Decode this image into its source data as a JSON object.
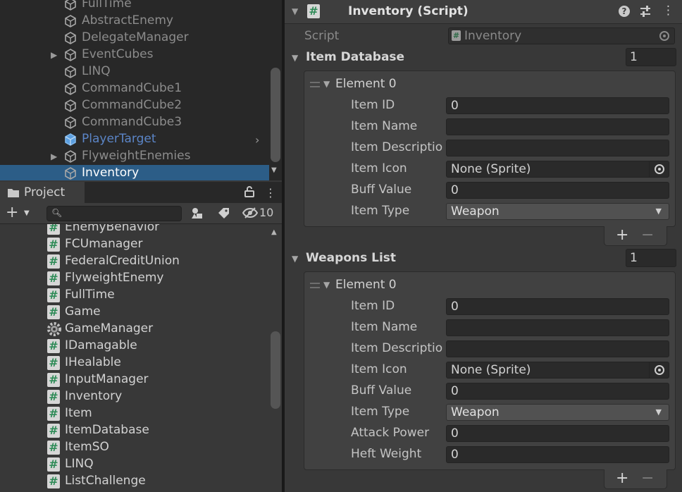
{
  "hierarchy": {
    "items": [
      {
        "label": "FullTime",
        "arrow": false,
        "style": "normal"
      },
      {
        "label": "AbstractEnemy",
        "arrow": false,
        "style": "normal"
      },
      {
        "label": "DelegateManager",
        "arrow": false,
        "style": "normal"
      },
      {
        "label": "EventCubes",
        "arrow": true,
        "style": "normal"
      },
      {
        "label": "LINQ",
        "arrow": false,
        "style": "normal"
      },
      {
        "label": "CommandCube1",
        "arrow": false,
        "style": "normal"
      },
      {
        "label": "CommandCube2",
        "arrow": false,
        "style": "normal"
      },
      {
        "label": "CommandCube3",
        "arrow": false,
        "style": "normal"
      },
      {
        "label": "PlayerTarget",
        "arrow": false,
        "style": "prefab"
      },
      {
        "label": "FlyweightEnemies",
        "arrow": true,
        "style": "normal"
      },
      {
        "label": "Inventory",
        "arrow": false,
        "style": "selected"
      }
    ]
  },
  "project": {
    "tab_label": "Project",
    "search_placeholder": "",
    "hidden_count": "10",
    "files": [
      {
        "label": "EnemyBehavior",
        "icon": "script"
      },
      {
        "label": "FCUmanager",
        "icon": "script"
      },
      {
        "label": "FederalCreditUnion",
        "icon": "script"
      },
      {
        "label": "FlyweightEnemy",
        "icon": "script"
      },
      {
        "label": "FullTime",
        "icon": "script"
      },
      {
        "label": "Game",
        "icon": "script"
      },
      {
        "label": "GameManager",
        "icon": "gear"
      },
      {
        "label": "IDamagable",
        "icon": "script"
      },
      {
        "label": "IHealable",
        "icon": "script"
      },
      {
        "label": "InputManager",
        "icon": "script"
      },
      {
        "label": "Inventory",
        "icon": "script"
      },
      {
        "label": "Item",
        "icon": "script"
      },
      {
        "label": "ItemDatabase",
        "icon": "script"
      },
      {
        "label": "ItemSO",
        "icon": "script"
      },
      {
        "label": "LINQ",
        "icon": "script"
      },
      {
        "label": "ListChallenge",
        "icon": "script"
      }
    ]
  },
  "inspector": {
    "component_title": "Inventory (Script)",
    "script_label": "Script",
    "script_value": "Inventory",
    "item_database": {
      "title": "Item Database",
      "size": "1",
      "element_title": "Element 0",
      "fields": {
        "item_id": {
          "label": "Item ID",
          "value": "0"
        },
        "item_name": {
          "label": "Item Name",
          "value": ""
        },
        "item_description": {
          "label": "Item Descriptio",
          "value": ""
        },
        "item_icon": {
          "label": "Item Icon",
          "value": "None (Sprite)"
        },
        "buff_value": {
          "label": "Buff Value",
          "value": "0"
        },
        "item_type": {
          "label": "Item Type",
          "value": "Weapon"
        }
      }
    },
    "weapons_list": {
      "title": "Weapons List",
      "size": "1",
      "element_title": "Element 0",
      "fields": {
        "item_id": {
          "label": "Item ID",
          "value": "0"
        },
        "item_name": {
          "label": "Item Name",
          "value": ""
        },
        "item_description": {
          "label": "Item Descriptio",
          "value": ""
        },
        "item_icon": {
          "label": "Item Icon",
          "value": "None (Sprite)"
        },
        "buff_value": {
          "label": "Buff Value",
          "value": "0"
        },
        "item_type": {
          "label": "Item Type",
          "value": "Weapon"
        },
        "attack_power": {
          "label": "Attack Power",
          "value": "0"
        },
        "heft_weight": {
          "label": "Heft Weight",
          "value": "0"
        }
      }
    },
    "add_symbol": "+",
    "remove_symbol": "−"
  }
}
